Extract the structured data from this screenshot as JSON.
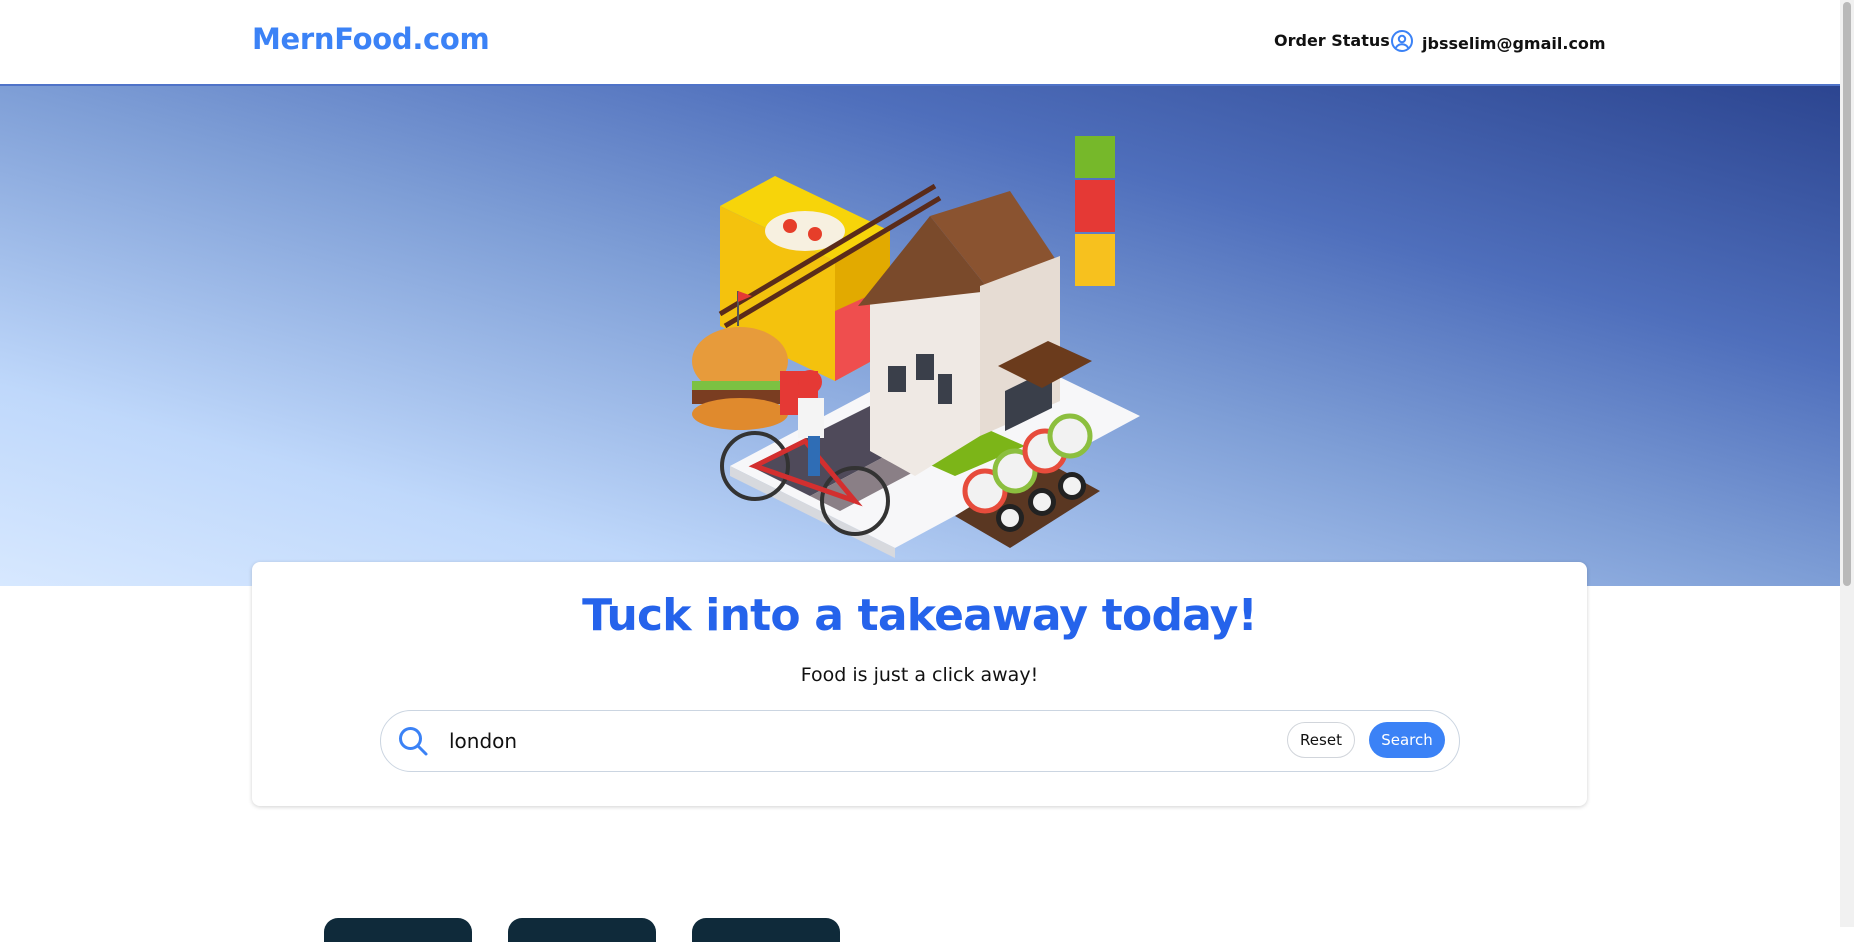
{
  "header": {
    "logo": "MernFood.com",
    "order_status": "Order Status",
    "user_email": "jbsselim@gmail.com"
  },
  "hero": {
    "headline": "Tuck into a takeaway today!",
    "subline": "Food is just a click away!"
  },
  "search": {
    "value": "london",
    "reset_label": "Reset",
    "search_label": "Search"
  },
  "colors": {
    "brand": "#3b82f6",
    "headline": "#2563eb"
  },
  "icons": [
    "user-circle-icon",
    "search-icon"
  ]
}
